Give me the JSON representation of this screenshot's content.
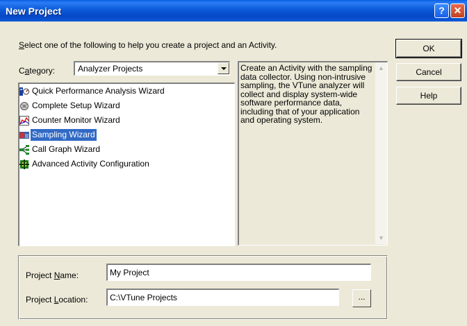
{
  "window": {
    "title": "New Project",
    "help_glyph": "?",
    "close_glyph": "✕"
  },
  "instruction": {
    "prefix": "S",
    "rest": "elect one of the following to help you create a project and an Activity."
  },
  "category": {
    "label_prefix": "C",
    "label_accel": "a",
    "label_rest": "tegory:",
    "selected": "Analyzer Projects"
  },
  "wizards": [
    {
      "label": "Quick Performance Analysis Wizard",
      "icon": "quick-analysis-icon",
      "selected": false
    },
    {
      "label": "Complete Setup Wizard",
      "icon": "setup-wizard-icon",
      "selected": false
    },
    {
      "label": "Counter Monitor Wizard",
      "icon": "counter-monitor-icon",
      "selected": false
    },
    {
      "label": "Sampling Wizard",
      "icon": "sampling-icon",
      "selected": true
    },
    {
      "label": "Call Graph Wizard",
      "icon": "call-graph-icon",
      "selected": false
    },
    {
      "label": "Advanced Activity Configuration",
      "icon": "advanced-config-icon",
      "selected": false
    }
  ],
  "description": "Create an Activity with the sampling data collector. Using non-intrusive sampling, the VTune analyzer will collect and display system-wide software performance data, including that of your application and operating system.",
  "buttons": {
    "ok": "OK",
    "cancel": "Cancel",
    "help": "Help",
    "browse": "..."
  },
  "project": {
    "name_label_pre": "Project ",
    "name_label_accel": "N",
    "name_label_rest": "ame:",
    "name_value": "My Project",
    "location_label_pre": "Project ",
    "location_label_accel": "L",
    "location_label_rest": "ocation:",
    "location_value": "C:\\VTune Projects"
  },
  "colors": {
    "titlebar": "#0a5ad8",
    "selection": "#316ac5",
    "dialog_bg": "#ece9d8"
  }
}
